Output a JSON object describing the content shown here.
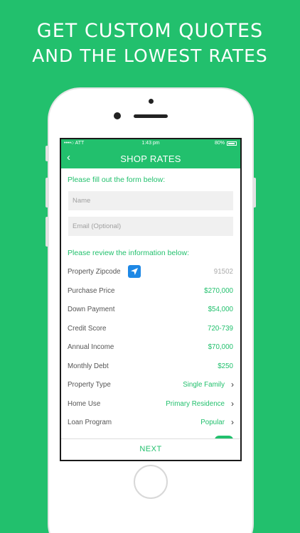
{
  "promo": {
    "line1": "GET CUSTOM QUOTES",
    "line2": "AND THE LOWEST RATES"
  },
  "status_bar": {
    "carrier": "ATT",
    "time": "1:43 pm",
    "battery": "80%"
  },
  "nav": {
    "back_icon": "chevron-left-icon",
    "title": "SHOP RATES"
  },
  "form": {
    "section_title": "Please fill out the form below:",
    "name_placeholder": "Name",
    "email_placeholder": "Email (Optional)"
  },
  "review": {
    "section_title": "Please review the information below:",
    "rows": [
      {
        "label": "Property Zipcode",
        "value": "91502"
      },
      {
        "label": "Purchase Price",
        "value": "$270,000"
      },
      {
        "label": "Down Payment",
        "value": "$54,000"
      },
      {
        "label": "Credit Score",
        "value": "720-739"
      },
      {
        "label": "Annual Income",
        "value": "$70,000"
      },
      {
        "label": "Monthly Debt",
        "value": "$250"
      },
      {
        "label": "Property Type",
        "value": "Single Family"
      },
      {
        "label": "Home Use",
        "value": "Primary Residence"
      },
      {
        "label": "Loan Program",
        "value": "Popular"
      }
    ]
  },
  "footer": {
    "next_label": "NEXT"
  },
  "colors": {
    "brand_green": "#22c06d",
    "location_blue": "#1e88e5"
  }
}
